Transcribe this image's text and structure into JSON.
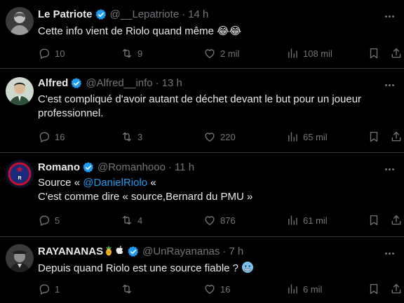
{
  "tweets": [
    {
      "name": "Le Patriote",
      "handle": "@__Lepatriote",
      "time": "14 h",
      "text_lines": [
        "Cette info vient de Riolo quand même 😂😂"
      ],
      "replies": "10",
      "retweets": "9",
      "likes": "2 mil",
      "views": "108 mil"
    },
    {
      "name": "Alfred",
      "handle": "@Alfred__info",
      "time": "13 h",
      "text_lines": [
        "C'est compliqué d'avoir autant de déchet devant le but pour un joueur",
        "professionnel."
      ],
      "replies": "16",
      "retweets": "3",
      "likes": "220",
      "views": "65 mil"
    },
    {
      "name": "Romano",
      "handle": "@Romanhooo",
      "time": "11 h",
      "text_line1_before": "Source « ",
      "mention": "@DanielRiolo",
      "text_line1_after": " «",
      "text_line2": "C'est comme dire « source,Bernard du PMU »",
      "replies": "5",
      "retweets": "4",
      "likes": "876",
      "views": "61 mil"
    },
    {
      "name": "RAYANANAS",
      "handle": "@UnRayananas",
      "time": "7 h",
      "text": "Depuis quand Riolo est une source fiable ?",
      "replies": "1",
      "retweets": "",
      "likes": "16",
      "views": "6 mil"
    }
  ],
  "separator": "·",
  "icons": {
    "reply": "reply-icon",
    "retweet": "retweet-icon",
    "like": "heart-icon",
    "views": "views-icon",
    "bookmark": "bookmark-icon",
    "share": "share-icon",
    "verified": "verified-badge-icon",
    "more": "more-icon"
  },
  "colors": {
    "background": "#000000",
    "text": "#e7e9ea",
    "muted": "#71767b",
    "accent": "#1d9bf0",
    "divider": "#2f3336"
  }
}
